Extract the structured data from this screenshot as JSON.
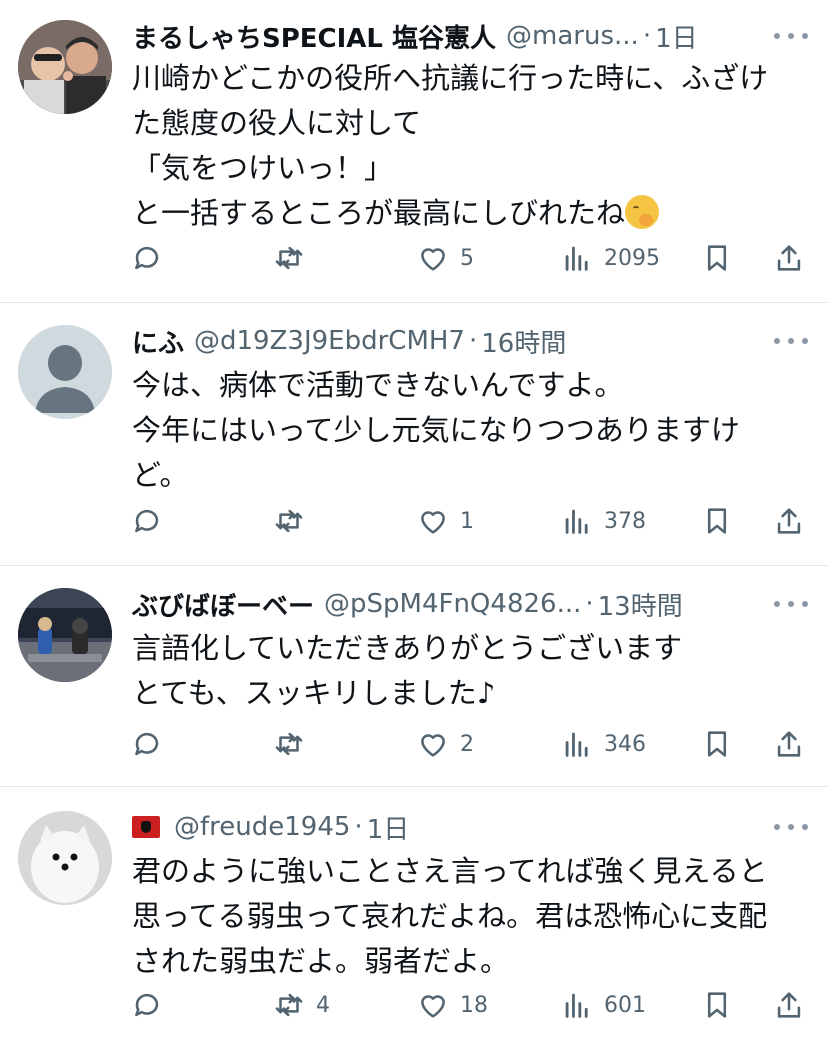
{
  "tweets": [
    {
      "name": "まるしゃちSPECIAL 塩谷憲人",
      "handle": "@marus...",
      "sep": "·",
      "time": "1日",
      "lines": [
        "川崎かどこかの役所へ抗議に行った時に、ふざけ",
        "た態度の役人に対して",
        "「気をつけいっ！」",
        "と一括するところが最高にしびれたね"
      ],
      "emoji": "hand-over-mouth-emoji",
      "reply_count": "",
      "retweet_count": "",
      "like_count": "5",
      "view_count": "2095"
    },
    {
      "name": "にふ",
      "handle": "@d19Z3J9EbdrCMH7",
      "sep": "·",
      "time": "16時間",
      "lines": [
        "今は、病体で活動できないんですよ。",
        "今年にはいって少し元気になりつつありますけ",
        "ど。"
      ],
      "reply_count": "",
      "retweet_count": "",
      "like_count": "1",
      "view_count": "378"
    },
    {
      "name": "ぶびばぼーベー",
      "handle": "@pSpM4FnQ4826...",
      "sep": "·",
      "time": "13時間",
      "lines": [
        "言語化していただきありがとうございます",
        "とても、スッキリしました♪"
      ],
      "reply_count": "",
      "retweet_count": "",
      "like_count": "2",
      "view_count": "346"
    },
    {
      "name": "",
      "flag": "albania-flag",
      "handle": "@freude1945",
      "sep": "·",
      "time": "1日",
      "lines": [
        "君のように強いことさえ言ってれば強く見えると",
        "思ってる弱虫って哀れだよね。君は恐怖心に支配",
        "された弱虫だよ。弱者だよ。"
      ],
      "reply_count": "",
      "retweet_count": "4",
      "like_count": "18",
      "view_count": "601"
    }
  ],
  "icons": {
    "reply": "reply-icon",
    "retweet": "retweet-icon",
    "like": "heart-icon",
    "views": "views-icon",
    "bookmark": "bookmark-icon",
    "share": "share-icon",
    "more": "more-icon"
  },
  "colors": {
    "text": "#0f1419",
    "secondary": "#536471",
    "divider": "#e7e9ea"
  }
}
